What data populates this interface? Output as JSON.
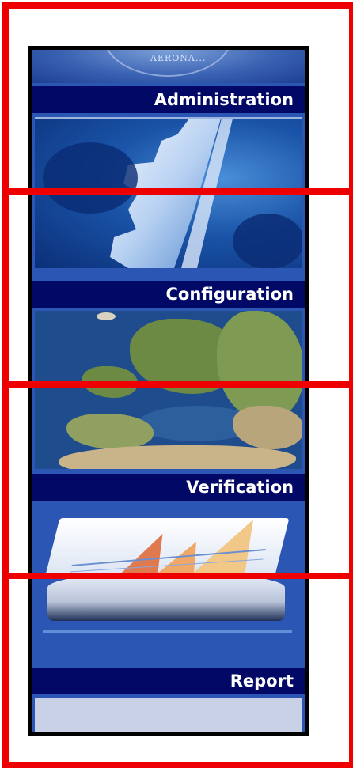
{
  "logo": {
    "text": "AERONA..."
  },
  "sections": [
    {
      "label": "Administration",
      "icon": "gear-icon"
    },
    {
      "label": "Configuration",
      "icon": "map-icon"
    },
    {
      "label": "Verification",
      "icon": "chart-icon"
    },
    {
      "label": "Report",
      "icon": ""
    }
  ],
  "colors": {
    "header_bg": "#020866",
    "panel_bg": "#2b56b3",
    "frame": "#000000",
    "highlight_outline": "#ee0000",
    "footer_bg": "#c9d1e6"
  }
}
